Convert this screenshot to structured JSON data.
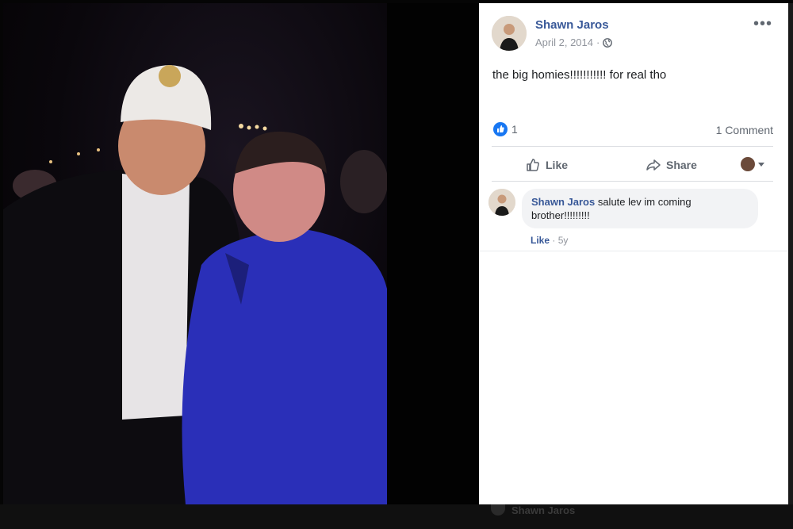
{
  "post": {
    "author": "Shawn Jaros",
    "date": "April 2, 2014",
    "meta_separator": "·",
    "text": "the big homies!!!!!!!!!!! for real tho",
    "more_label": "•••"
  },
  "reactions": {
    "count": "1",
    "comments_label": "1 Comment"
  },
  "actions": {
    "like": "Like",
    "share": "Share"
  },
  "comment": {
    "author": "Shawn Jaros",
    "text": "salute lev im coming brother!!!!!!!!!",
    "like_label": "Like",
    "separator": "·",
    "age": "5y"
  },
  "colors": {
    "link_blue": "#385898",
    "like_blue": "#1877f2",
    "jacket_blue": "#2a2fb8"
  },
  "icons": {
    "globe": "globe-icon",
    "like": "thumbs-up-icon",
    "share": "share-arrow-icon"
  }
}
